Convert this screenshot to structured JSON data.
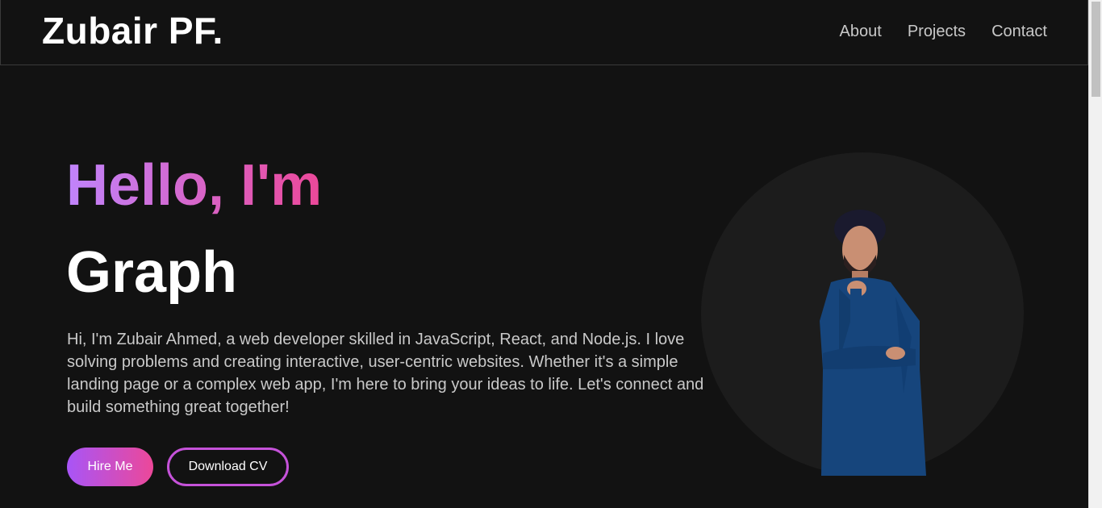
{
  "brand": {
    "name": "Zubair PF."
  },
  "nav": {
    "items": [
      {
        "label": "About"
      },
      {
        "label": "Projects"
      },
      {
        "label": "Contact"
      }
    ]
  },
  "hero": {
    "greeting": "Hello, I'm",
    "role": "Graph",
    "description": "Hi, I'm Zubair Ahmed, a web developer skilled in JavaScript, React, and Node.js. I love solving problems and creating interactive, user-centric websites. Whether it's a simple landing page or a complex web app, I'm here to bring your ideas to life. Let's connect and build something great together!",
    "primary_button": "Hire Me",
    "secondary_button": "Download CV"
  },
  "colors": {
    "background": "#121212",
    "gradient_start": "#a855f7",
    "gradient_end": "#ec4899",
    "text": "#ffffff",
    "muted_text": "#c9c9c9"
  }
}
